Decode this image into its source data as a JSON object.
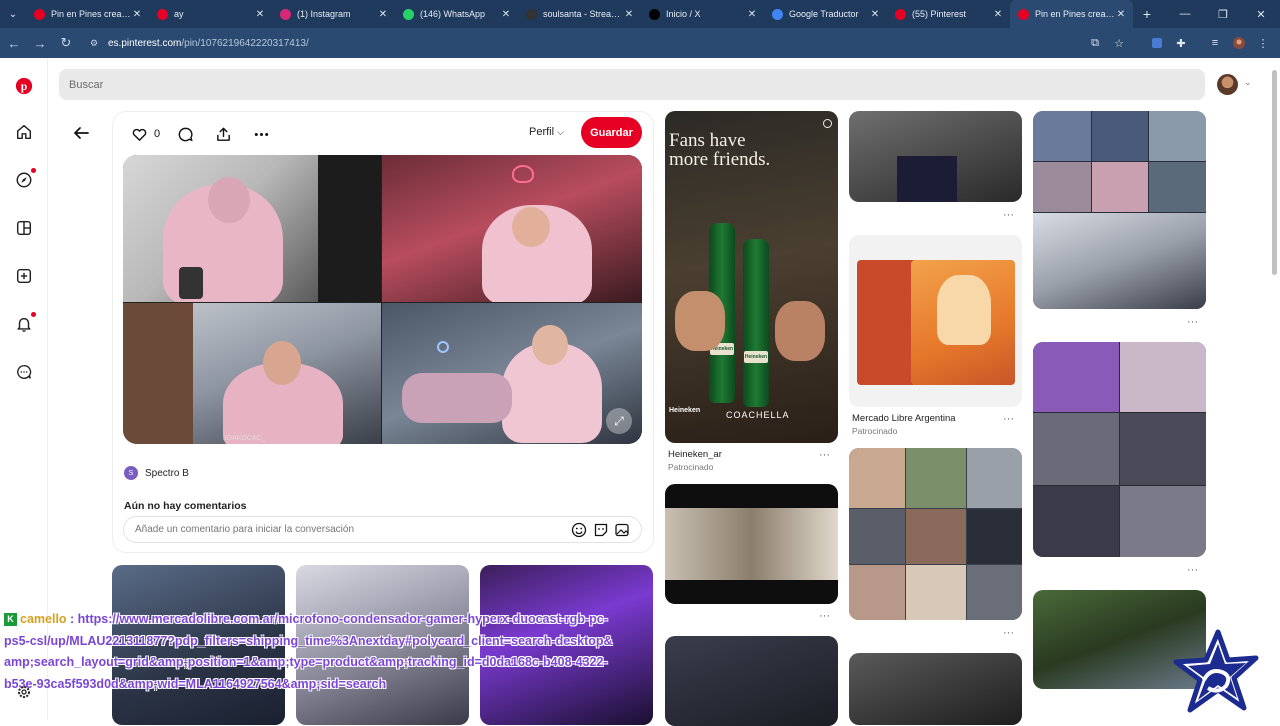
{
  "browser": {
    "tabs": [
      {
        "title": "Pin en Pines creados",
        "favicon": "pinterest-icon",
        "color": "#e60023",
        "active": false
      },
      {
        "title": "ay",
        "favicon": "pinterest-icon",
        "color": "#e60023",
        "active": false
      },
      {
        "title": "(1) Instagram",
        "favicon": "instagram-icon",
        "color": "#d62976",
        "active": false
      },
      {
        "title": "(146) WhatsApp",
        "favicon": "whatsapp-icon",
        "color": "#25d366",
        "active": false
      },
      {
        "title": "soulsanta - Streamsta",
        "favicon": "streamsta-icon",
        "color": "#333333",
        "active": false
      },
      {
        "title": "Inicio / X",
        "favicon": "x-icon",
        "color": "#000000",
        "active": false
      },
      {
        "title": "Google Traductor",
        "favicon": "translate-icon",
        "color": "#4285f4",
        "active": false
      },
      {
        "title": "(55) Pinterest",
        "favicon": "pinterest-icon",
        "color": "#e60023",
        "active": false
      },
      {
        "title": "Pin en Pines creados",
        "favicon": "pinterest-icon",
        "color": "#e60023",
        "active": true
      }
    ],
    "url_host": "es.pinterest.com",
    "url_path": "/pin/1076219642220317413/"
  },
  "search": {
    "placeholder": "Buscar"
  },
  "pin": {
    "like_count": "0",
    "profile_label": "Perfil",
    "save_label": "Guardar",
    "image_watermark": "JOAKOCAC_",
    "author_initial": "S",
    "author_name": "Spectro B",
    "comments_heading": "Aún no hay comentarios",
    "comment_placeholder": "Añade un comentario para iniciar la conversación"
  },
  "grid": {
    "heineken": {
      "ad_line1": "Fans have",
      "ad_line2": "more friends.",
      "brand": "Heineken",
      "event": "COACHELLA",
      "title": "Heineken_ar",
      "subtitle": "Patrocinado"
    },
    "mercado": {
      "title": "Mercado Libre Argentina",
      "subtitle": "Patrocinado"
    },
    "more_label": "···"
  },
  "chat_overlay": {
    "username": "camello",
    "separator": " : ",
    "message": "https://www.mercadolibre.com.ar/microfono-condensador-gamer-hyperx-duocast-rgb-pc-ps5-csl/up/MLAU221311877?pdp_filters=shipping_time%3Anextday#polycard_client=search-desktop&amp;search_layout=grid&amp;position=1&amp;type=product&amp;tracking_id=d0da168c-b408-4322-b53e-93ca5f593d0d&amp;wid=MLA1164927564&amp;sid=search"
  },
  "colors": {
    "accent": "#e60023",
    "chat_text": "#7b46d6",
    "chat_user": "#d6a020",
    "browser_bg": "#1f3a5c"
  }
}
